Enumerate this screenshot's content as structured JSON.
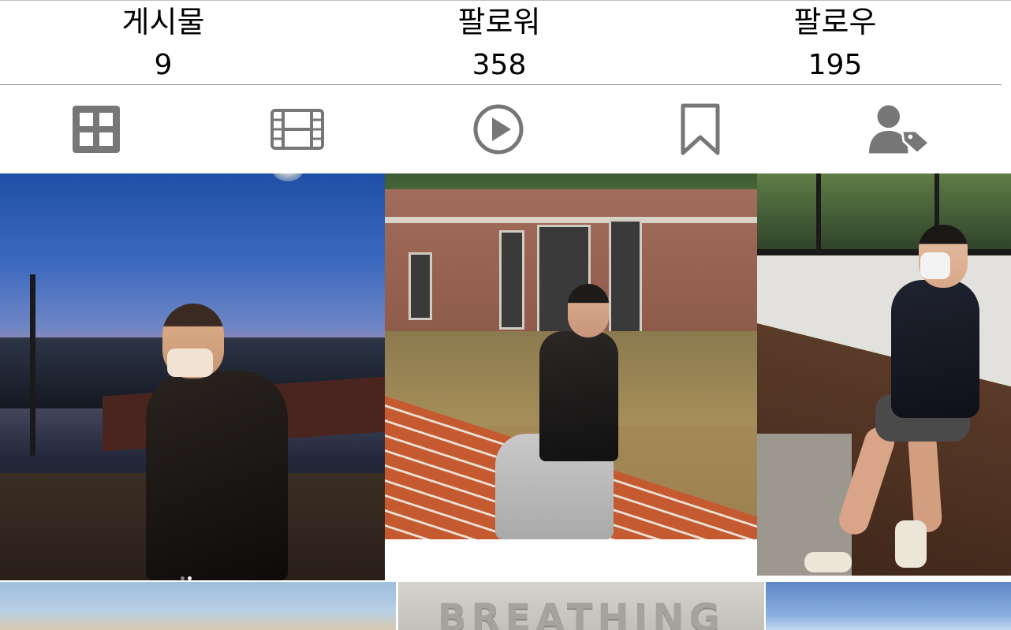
{
  "stats": {
    "posts": {
      "label": "게시물",
      "count": "9"
    },
    "followers": {
      "label": "팔로워",
      "count": "358"
    },
    "following": {
      "label": "팔로우",
      "count": "195"
    }
  },
  "tabs": [
    {
      "icon": "grid-icon",
      "active": true
    },
    {
      "icon": "film-icon",
      "active": false
    },
    {
      "icon": "play-circle-icon",
      "active": false
    },
    {
      "icon": "bookmark-icon",
      "active": false
    },
    {
      "icon": "tagged-user-icon",
      "active": false
    }
  ],
  "colors": {
    "icon": "#777777",
    "divider": "#8a8a8a"
  },
  "posts": [
    {
      "kind": "photo",
      "scene": "night city view",
      "carousel_dots": 2,
      "current_dot": 2
    },
    {
      "kind": "photo",
      "scene": "brick building rooftop"
    },
    {
      "kind": "photo",
      "scene": "cafe terrace bench"
    },
    {
      "kind": "photo",
      "scene": "sky"
    },
    {
      "kind": "photo",
      "scene": "wall sign",
      "text": "BREATHING"
    },
    {
      "kind": "photo",
      "scene": "blue sky"
    }
  ]
}
